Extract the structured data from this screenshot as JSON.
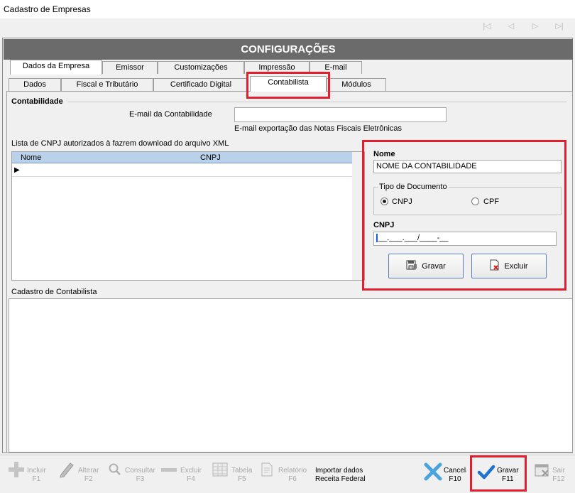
{
  "window": {
    "title": "Cadastro de Empresas"
  },
  "header": {
    "title": "CONFIGURAÇÕES"
  },
  "tabs_row1": [
    "Dados da Empresa",
    "Emissor",
    "Customizações",
    "Impressão",
    "E-mail"
  ],
  "tabs_row2": [
    "Dados",
    "Fiscal e Tributário",
    "Certificado Digital",
    "Contabilista",
    "Módulos"
  ],
  "contabilidade": {
    "section_label": "Contabilidade",
    "email_label": "E-mail da Contabilidade",
    "email_value": "",
    "email_hint": "E-mail exportação das Notas Fiscais Eletrônicas"
  },
  "cnpj_list": {
    "label": "Lista de CNPJ autorizados à fazrem download do arquivo XML",
    "columns": [
      "Nome",
      "CNPJ"
    ]
  },
  "form": {
    "nome_label": "Nome",
    "nome_value": "NOME DA CONTABILIDADE",
    "tipo_doc_label": "Tipo de Documento",
    "radio_cnpj": "CNPJ",
    "radio_cpf": "CPF",
    "selected": "CNPJ",
    "cnpj_label": "CNPJ",
    "cnpj_value": "__.___.___/____-__",
    "gravar_label": "Gravar",
    "excluir_label": "Excluir"
  },
  "cadastro": {
    "label": "Cadastro de Contabilista"
  },
  "toolbar": {
    "incluir": "Incluir",
    "incluir_key": "F1",
    "alterar": "Alterar",
    "alterar_key": "F2",
    "consultar": "Consultar",
    "consultar_key": "F3",
    "excluir": "Excluir",
    "excluir_key": "F4",
    "tabela": "Tabela",
    "tabela_key": "F5",
    "relatorio": "Relatório",
    "relatorio_key": "F6",
    "importar_line1": "Importar dados",
    "importar_line2": "Receita Federal",
    "cancelar": "Cancelar",
    "cancelar_key": "F10",
    "gravar": "Gravar",
    "gravar_key": "F11",
    "sair": "Sair",
    "sair_key": "F12"
  },
  "colors": {
    "accent_red": "#e0202e",
    "header_gray": "#6b6b6b",
    "grid_header": "#b9d1ea",
    "check_blue": "#1e73d2",
    "cancel_blue": "#4aa3df"
  }
}
